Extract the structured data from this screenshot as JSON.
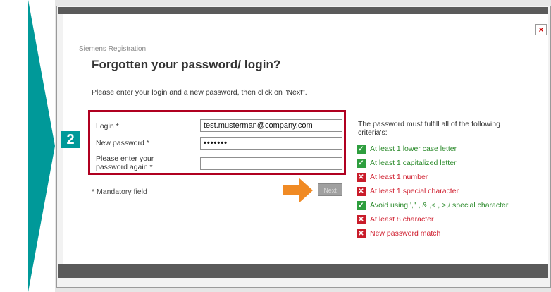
{
  "step_number": "2",
  "dialog": {
    "brand": "Siemens Registration",
    "title": "Forgotten your password/ login?",
    "instruction": "Please enter your login and a new password, then click on \"Next\".",
    "close_label": "×"
  },
  "form": {
    "login_label": "Login *",
    "login_value": "test.musterman@company.com",
    "new_password_label": "New password *",
    "new_password_value": "•••••••",
    "repeat_label_line1": "Please enter your",
    "repeat_label_line2": "password again *",
    "repeat_value": "",
    "mandatory_note": "* Mandatory field",
    "next_label": "Next"
  },
  "criteria": {
    "heading_line1": "The password must fulfill all of the following",
    "heading_line2": "criteria's:",
    "items": [
      {
        "text": "At least 1 lower case letter",
        "status": "ok"
      },
      {
        "text": "At least 1 capitalized letter",
        "status": "ok"
      },
      {
        "text": "At least 1 number",
        "status": "fail"
      },
      {
        "text": "At least 1 special character",
        "status": "fail"
      },
      {
        "text": "Avoid using ',\" , & ,< , >,/ special character",
        "status": "ok"
      },
      {
        "text": "At least 8 character",
        "status": "fail"
      },
      {
        "text": "New password match",
        "status": "fail"
      }
    ],
    "ok_symbol": "✓",
    "fail_symbol": "✕"
  },
  "colors": {
    "teal": "#009999",
    "highlight_border": "#b00020",
    "ok_green": "#2e9e3e",
    "fail_red": "#c91c2a",
    "arrow_orange": "#f08a24"
  }
}
